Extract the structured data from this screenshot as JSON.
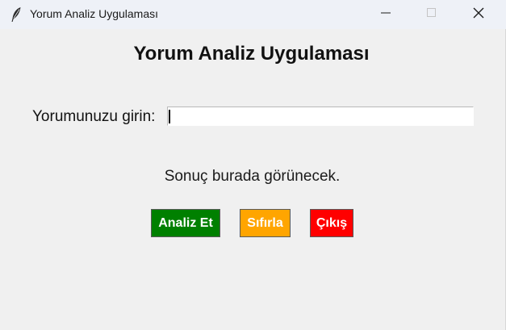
{
  "window": {
    "title": "Yorum Analiz Uygulaması",
    "controls": {
      "minimize": "minimize-icon",
      "maximize": "maximize-icon",
      "close": "close-icon"
    },
    "app_icon": "feather-icon"
  },
  "main": {
    "heading": "Yorum Analiz Uygulaması",
    "input_label": "Yorumunuzu girin:",
    "input_value": "",
    "result_text": "Sonuç burada görünecek."
  },
  "buttons": {
    "analyze": {
      "label": "Analiz Et",
      "color": "#008000"
    },
    "reset": {
      "label": "Sıfırla",
      "color": "#ffa500"
    },
    "exit": {
      "label": "Çıkış",
      "color": "#ff0000"
    }
  },
  "colors": {
    "background": "#f0f0f0",
    "titlebar": "#eef1f7"
  }
}
